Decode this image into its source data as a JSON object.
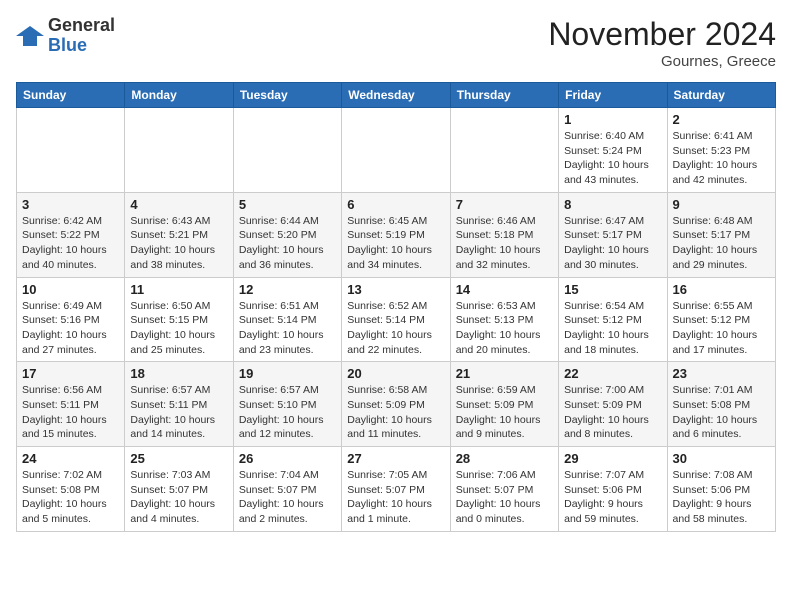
{
  "header": {
    "logo_general": "General",
    "logo_blue": "Blue",
    "month_title": "November 2024",
    "location": "Gournes, Greece"
  },
  "weekdays": [
    "Sunday",
    "Monday",
    "Tuesday",
    "Wednesday",
    "Thursday",
    "Friday",
    "Saturday"
  ],
  "weeks": [
    [
      {
        "day": "",
        "info": ""
      },
      {
        "day": "",
        "info": ""
      },
      {
        "day": "",
        "info": ""
      },
      {
        "day": "",
        "info": ""
      },
      {
        "day": "",
        "info": ""
      },
      {
        "day": "1",
        "info": "Sunrise: 6:40 AM\nSunset: 5:24 PM\nDaylight: 10 hours\nand 43 minutes."
      },
      {
        "day": "2",
        "info": "Sunrise: 6:41 AM\nSunset: 5:23 PM\nDaylight: 10 hours\nand 42 minutes."
      }
    ],
    [
      {
        "day": "3",
        "info": "Sunrise: 6:42 AM\nSunset: 5:22 PM\nDaylight: 10 hours\nand 40 minutes."
      },
      {
        "day": "4",
        "info": "Sunrise: 6:43 AM\nSunset: 5:21 PM\nDaylight: 10 hours\nand 38 minutes."
      },
      {
        "day": "5",
        "info": "Sunrise: 6:44 AM\nSunset: 5:20 PM\nDaylight: 10 hours\nand 36 minutes."
      },
      {
        "day": "6",
        "info": "Sunrise: 6:45 AM\nSunset: 5:19 PM\nDaylight: 10 hours\nand 34 minutes."
      },
      {
        "day": "7",
        "info": "Sunrise: 6:46 AM\nSunset: 5:18 PM\nDaylight: 10 hours\nand 32 minutes."
      },
      {
        "day": "8",
        "info": "Sunrise: 6:47 AM\nSunset: 5:17 PM\nDaylight: 10 hours\nand 30 minutes."
      },
      {
        "day": "9",
        "info": "Sunrise: 6:48 AM\nSunset: 5:17 PM\nDaylight: 10 hours\nand 29 minutes."
      }
    ],
    [
      {
        "day": "10",
        "info": "Sunrise: 6:49 AM\nSunset: 5:16 PM\nDaylight: 10 hours\nand 27 minutes."
      },
      {
        "day": "11",
        "info": "Sunrise: 6:50 AM\nSunset: 5:15 PM\nDaylight: 10 hours\nand 25 minutes."
      },
      {
        "day": "12",
        "info": "Sunrise: 6:51 AM\nSunset: 5:14 PM\nDaylight: 10 hours\nand 23 minutes."
      },
      {
        "day": "13",
        "info": "Sunrise: 6:52 AM\nSunset: 5:14 PM\nDaylight: 10 hours\nand 22 minutes."
      },
      {
        "day": "14",
        "info": "Sunrise: 6:53 AM\nSunset: 5:13 PM\nDaylight: 10 hours\nand 20 minutes."
      },
      {
        "day": "15",
        "info": "Sunrise: 6:54 AM\nSunset: 5:12 PM\nDaylight: 10 hours\nand 18 minutes."
      },
      {
        "day": "16",
        "info": "Sunrise: 6:55 AM\nSunset: 5:12 PM\nDaylight: 10 hours\nand 17 minutes."
      }
    ],
    [
      {
        "day": "17",
        "info": "Sunrise: 6:56 AM\nSunset: 5:11 PM\nDaylight: 10 hours\nand 15 minutes."
      },
      {
        "day": "18",
        "info": "Sunrise: 6:57 AM\nSunset: 5:11 PM\nDaylight: 10 hours\nand 14 minutes."
      },
      {
        "day": "19",
        "info": "Sunrise: 6:57 AM\nSunset: 5:10 PM\nDaylight: 10 hours\nand 12 minutes."
      },
      {
        "day": "20",
        "info": "Sunrise: 6:58 AM\nSunset: 5:09 PM\nDaylight: 10 hours\nand 11 minutes."
      },
      {
        "day": "21",
        "info": "Sunrise: 6:59 AM\nSunset: 5:09 PM\nDaylight: 10 hours\nand 9 minutes."
      },
      {
        "day": "22",
        "info": "Sunrise: 7:00 AM\nSunset: 5:09 PM\nDaylight: 10 hours\nand 8 minutes."
      },
      {
        "day": "23",
        "info": "Sunrise: 7:01 AM\nSunset: 5:08 PM\nDaylight: 10 hours\nand 6 minutes."
      }
    ],
    [
      {
        "day": "24",
        "info": "Sunrise: 7:02 AM\nSunset: 5:08 PM\nDaylight: 10 hours\nand 5 minutes."
      },
      {
        "day": "25",
        "info": "Sunrise: 7:03 AM\nSunset: 5:07 PM\nDaylight: 10 hours\nand 4 minutes."
      },
      {
        "day": "26",
        "info": "Sunrise: 7:04 AM\nSunset: 5:07 PM\nDaylight: 10 hours\nand 2 minutes."
      },
      {
        "day": "27",
        "info": "Sunrise: 7:05 AM\nSunset: 5:07 PM\nDaylight: 10 hours\nand 1 minute."
      },
      {
        "day": "28",
        "info": "Sunrise: 7:06 AM\nSunset: 5:07 PM\nDaylight: 10 hours\nand 0 minutes."
      },
      {
        "day": "29",
        "info": "Sunrise: 7:07 AM\nSunset: 5:06 PM\nDaylight: 9 hours\nand 59 minutes."
      },
      {
        "day": "30",
        "info": "Sunrise: 7:08 AM\nSunset: 5:06 PM\nDaylight: 9 hours\nand 58 minutes."
      }
    ]
  ]
}
